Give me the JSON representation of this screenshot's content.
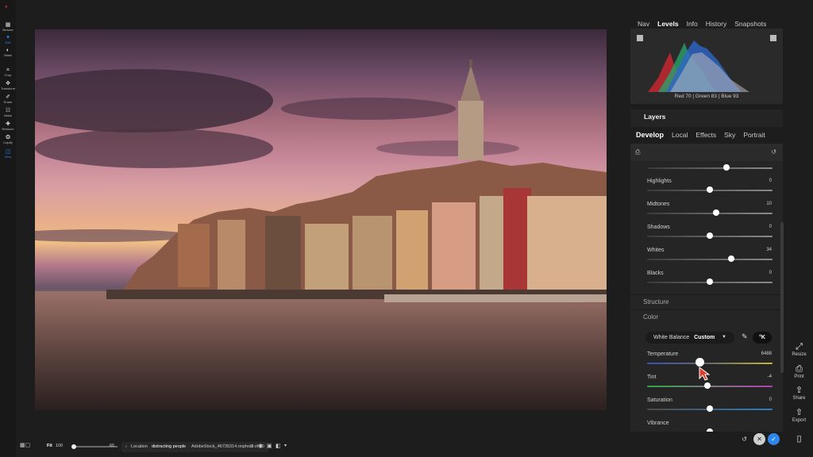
{
  "toolbar": {
    "tools": [
      {
        "label": "Browse",
        "icon": "browse-icon",
        "active": false
      },
      {
        "label": "Edit",
        "icon": "edit-icon",
        "active": true
      },
      {
        "label": "Mask",
        "icon": "mask-icon",
        "active": false
      },
      {
        "label": "Crop",
        "icon": "crop-icon",
        "active": false
      },
      {
        "label": "Transform",
        "icon": "transform-icon",
        "active": false
      },
      {
        "label": "Erase",
        "icon": "erase-icon",
        "active": false
      },
      {
        "label": "Mask",
        "icon": "mask-brush-icon",
        "active": false
      },
      {
        "label": "Retouch",
        "icon": "retouch-icon",
        "active": false
      },
      {
        "label": "Liquify",
        "icon": "liquify-icon",
        "active": false
      },
      {
        "label": "View",
        "icon": "view-icon",
        "active": true
      }
    ]
  },
  "panel": {
    "top_tabs": [
      "Nav",
      "Levels",
      "Info",
      "History",
      "Snapshots"
    ],
    "top_tab_active": "Levels",
    "histogram": {
      "red": 70,
      "green": 83,
      "blue": 93,
      "readout": "Red 70 | Green 83 | Blue 93"
    },
    "layers_title": "Layers",
    "develop_tabs": [
      "Develop",
      "Local",
      "Effects",
      "Sky",
      "Portrait"
    ],
    "develop_tab_active": "Develop",
    "tone": [
      {
        "label": "",
        "value": "",
        "pos": 0.63
      },
      {
        "label": "Highlights",
        "value": "0",
        "pos": 0.5
      },
      {
        "label": "Midtones",
        "value": "10",
        "pos": 0.55
      },
      {
        "label": "Shadows",
        "value": "0",
        "pos": 0.5
      },
      {
        "label": "Whites",
        "value": "34",
        "pos": 0.67
      },
      {
        "label": "Blacks",
        "value": "0",
        "pos": 0.5
      }
    ],
    "structure_label": "Structure",
    "color_label": "Color",
    "white_balance": {
      "label": "White Balance",
      "value": "Custom"
    },
    "kelvin_label": "°K",
    "color": [
      {
        "label": "Temperature",
        "value": "6488",
        "pos": 0.42,
        "track": "temp"
      },
      {
        "label": "Tint",
        "value": "-4",
        "pos": 0.48,
        "track": "tint"
      },
      {
        "label": "Saturation",
        "value": "0",
        "pos": 0.5,
        "track": "sat"
      },
      {
        "label": "Vibrance",
        "value": "",
        "pos": 0.5,
        "track": "sat"
      }
    ]
  },
  "side_actions": [
    {
      "label": "Resize",
      "icon": "resize-icon"
    },
    {
      "label": "Print",
      "icon": "print-icon"
    },
    {
      "label": "Share",
      "icon": "share-icon"
    },
    {
      "label": "Export",
      "icon": "export-icon"
    }
  ],
  "bottom": {
    "fit_label": "Fit",
    "zoom_value": "100",
    "zoom_right": "65",
    "location_label": "Location",
    "location_value": "distracting people",
    "filename": "AdobeStock_46735314.onphoto",
    "counter": "2 of 20"
  },
  "colors": {
    "accent": "#2f86ea",
    "panel": "#252525"
  }
}
